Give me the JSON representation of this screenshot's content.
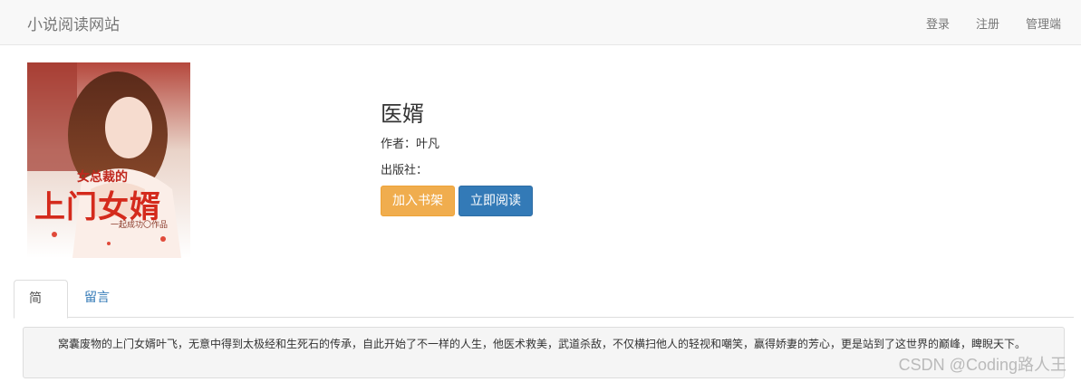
{
  "navbar": {
    "brand": "小说阅读网站",
    "links": [
      "登录",
      "注册",
      "管理端"
    ]
  },
  "cover": {
    "small_text": "女总裁的",
    "big_text": "上门女婿",
    "sub_text": "一起成功〇作品"
  },
  "book": {
    "title": "医婿",
    "author_line": "作者：叶凡",
    "publisher_line": "出版社：",
    "add_button": "加入书架",
    "read_button": "立即阅读"
  },
  "tabs": [
    "简介",
    "留言"
  ],
  "intro_text": "窝囊废物的上门女婿叶飞，无意中得到太极经和生死石的传承，自此开始了不一样的人生，他医术救美，武道杀敌，不仅横扫他人的轻视和嘲笑，赢得娇妻的芳心，更是站到了这世界的巅峰，睥睨天下。",
  "watermark": "CSDN @Coding路人王",
  "colors": {
    "warning": "#f0ad4e",
    "primary": "#337ab7",
    "navbar_bg": "#f8f8f8"
  }
}
